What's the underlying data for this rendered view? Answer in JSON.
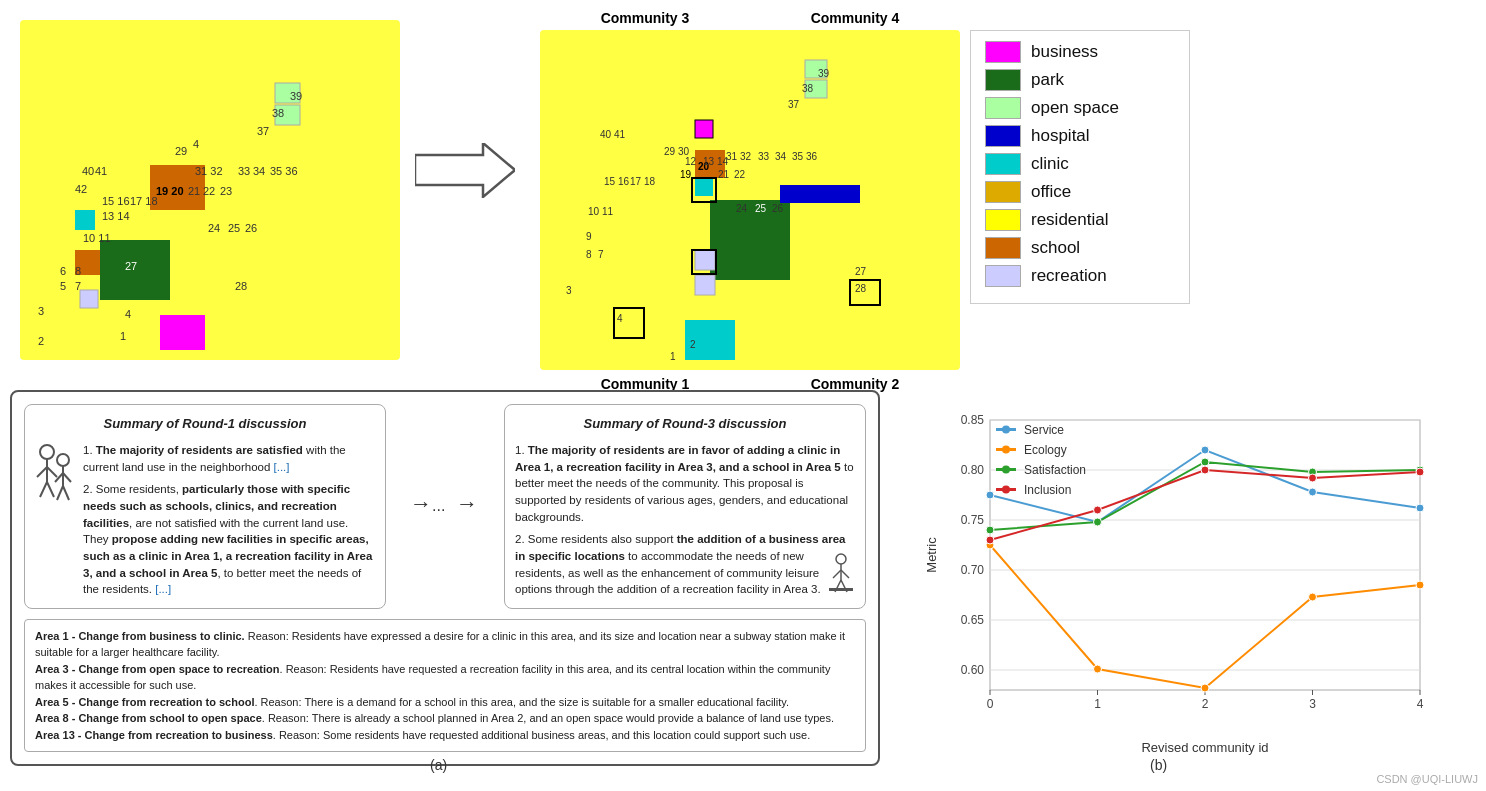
{
  "legend": {
    "items": [
      {
        "label": "business",
        "color": "#FF00FF"
      },
      {
        "label": "park",
        "color": "#1A6B1A"
      },
      {
        "label": "open space",
        "color": "#AAFFA0"
      },
      {
        "label": "hospital",
        "color": "#0000CC"
      },
      {
        "label": "clinic",
        "color": "#00CCCC"
      },
      {
        "label": "office",
        "color": "#DDAA00"
      },
      {
        "label": "residential",
        "color": "#FFFF00"
      },
      {
        "label": "school",
        "color": "#CC6600"
      },
      {
        "label": "recreation",
        "color": "#CCCCFF"
      }
    ]
  },
  "map_titles": {
    "community3": "Community 3",
    "community4": "Community 4",
    "community1": "Community 1",
    "community2": "Community 2"
  },
  "discussion": {
    "round1_title": "Summary of Round-1 discussion",
    "round3_title": "Summary of Round-3 discussion",
    "round1_p1": "1. The majority of residents are satisfied with the current land use in the neighborhood [...]",
    "round1_p2": "2. Some residents, particularly those with specific needs such as schools, clinics, and recreation facilities, are not satisfied with the current land use. They propose adding new facilities in specific areas, such as a clinic in Area 1, a recreation facility in Area 3, and a school in Area 5, to better meet the needs of the residents. [...]",
    "round3_p1": "1. The majority of residents are in favor of adding a clinic in Area 1, a recreation facility in Area 3, and a school in Area 5 to better meet the needs of the community. This proposal is supported by residents of various ages, genders, and educational backgrounds.",
    "round3_p2": "2. Some residents also support the addition of a business area in specific locations to accommodate the needs of new residents, as well as the enhancement of community leisure options through the addition of a recreation facility in Area 3."
  },
  "changes": {
    "items": [
      "Area 1 - Change from business to clinic. Reason: Residents have expressed a desire for a clinic in this area, and its size and location near a subway station make it suitable for a larger healthcare facility.",
      "Area 3 - Change from open space to recreation. Reason: Residents have requested a recreation facility in this area, and its central location within the community makes it accessible for such use.",
      "Area 5 - Change from recreation to school. Reason: There is a demand for a school in this area, and the size is suitable for a smaller educational facility.",
      "Area 8 - Change from school to open space. Reason: There is already a school planned in Area 2, and an open space would provide a balance of land use types.",
      "Area 13 - Change from recreation to business. Reason: Some residents have requested additional business areas, and this location could support such use."
    ]
  },
  "chart": {
    "title": "",
    "x_label": "Revised community id",
    "y_label": "Metric",
    "x_values": [
      0,
      1,
      2,
      3,
      4
    ],
    "series": [
      {
        "name": "Service",
        "color": "#4B9CD3",
        "values": [
          0.775,
          0.748,
          0.82,
          0.778,
          0.762
        ]
      },
      {
        "name": "Ecology",
        "color": "#FF8C00",
        "values": [
          0.725,
          0.601,
          0.582,
          0.673,
          0.685
        ]
      },
      {
        "name": "Satisfaction",
        "color": "#2CA02C",
        "values": [
          0.74,
          0.748,
          0.808,
          0.798,
          0.8
        ]
      },
      {
        "name": "Inclusion",
        "color": "#D62728",
        "values": [
          0.73,
          0.76,
          0.8,
          0.792,
          0.798
        ]
      }
    ],
    "y_min": 0.58,
    "y_max": 0.85
  },
  "captions": {
    "a": "(a)",
    "b": "(b)"
  },
  "watermark": "CSDN @UQI-LIUWJ"
}
